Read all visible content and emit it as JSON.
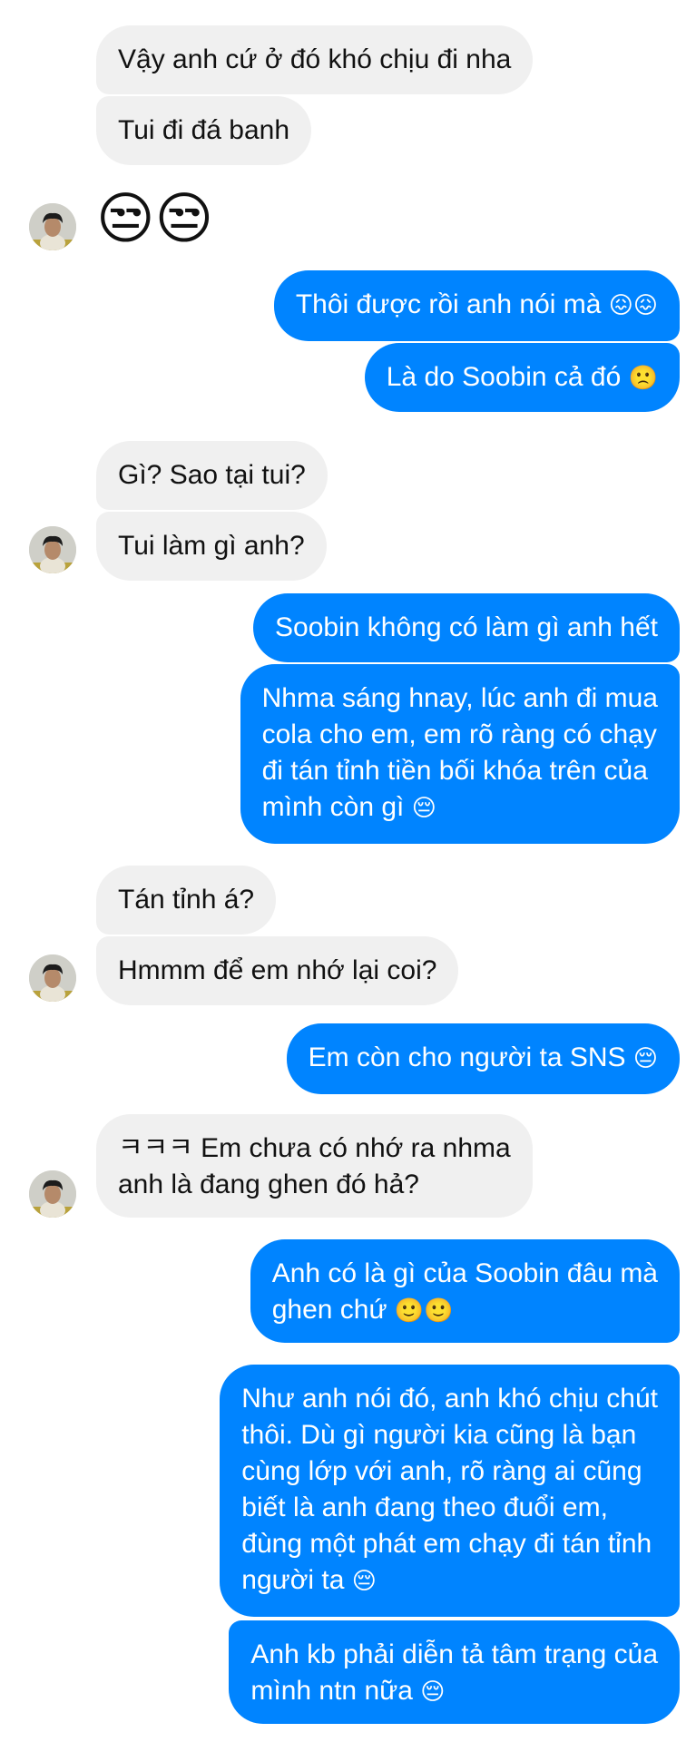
{
  "conversation": {
    "bubble_colors": {
      "incoming_bg": "#f0f0f0",
      "incoming_text": "#111111",
      "outgoing_bg": "#0084ff",
      "outgoing_text": "#ffffff"
    },
    "messages": [
      {
        "dir": "in",
        "lines": [
          "Vậy anh cứ ở đó khó chịu đi nha"
        ]
      },
      {
        "dir": "in",
        "lines": [
          "Tui đi đá banh"
        ]
      },
      {
        "dir": "in",
        "lines": [
          "😒😒"
        ],
        "emoji_only": true,
        "avatar": true
      },
      {
        "dir": "out",
        "lines": [
          "Thôi được rồi anh nói mà 😖😖"
        ]
      },
      {
        "dir": "out",
        "lines": [
          "Là do Soobin cả đó 🙁"
        ]
      },
      {
        "dir": "in",
        "lines": [
          "Gì? Sao tại tui?"
        ]
      },
      {
        "dir": "in",
        "lines": [
          "Tui làm gì anh?"
        ],
        "avatar": true
      },
      {
        "dir": "out",
        "lines": [
          "Soobin không có làm gì anh hết"
        ]
      },
      {
        "dir": "out",
        "lines": [
          "Nhma sáng hnay, lúc anh đi mua",
          "cola cho em, em rõ ràng có chạy",
          "đi tán tỉnh tiền bối khóa trên của",
          "mình còn gì 😔"
        ]
      },
      {
        "dir": "in",
        "lines": [
          "Tán tỉnh á?"
        ]
      },
      {
        "dir": "in",
        "lines": [
          "Hmmm để em nhớ lại coi?"
        ],
        "avatar": true
      },
      {
        "dir": "out",
        "lines": [
          "Em còn cho người ta SNS 😔"
        ]
      },
      {
        "dir": "in",
        "lines": [
          "ㅋㅋㅋ Em chưa có nhớ ra nhma",
          "anh là đang ghen đó hả?"
        ],
        "avatar": true
      },
      {
        "dir": "out",
        "lines": [
          "Anh có là gì của Soobin đâu mà",
          "ghen chứ 🙂🙂"
        ]
      },
      {
        "dir": "out",
        "lines": [
          "Như anh nói đó, anh khó chịu chút",
          "thôi. Dù gì người kia cũng là bạn",
          "cùng lớp với anh, rõ ràng ai cũng",
          "biết là anh đang theo đuổi em,",
          "đùng một phát em chạy đi tán tỉnh",
          "người ta 😔"
        ]
      },
      {
        "dir": "out",
        "lines": [
          "Anh kb phải diễn tả tâm trạng của",
          "mình ntn nữa 😔"
        ]
      }
    ]
  }
}
